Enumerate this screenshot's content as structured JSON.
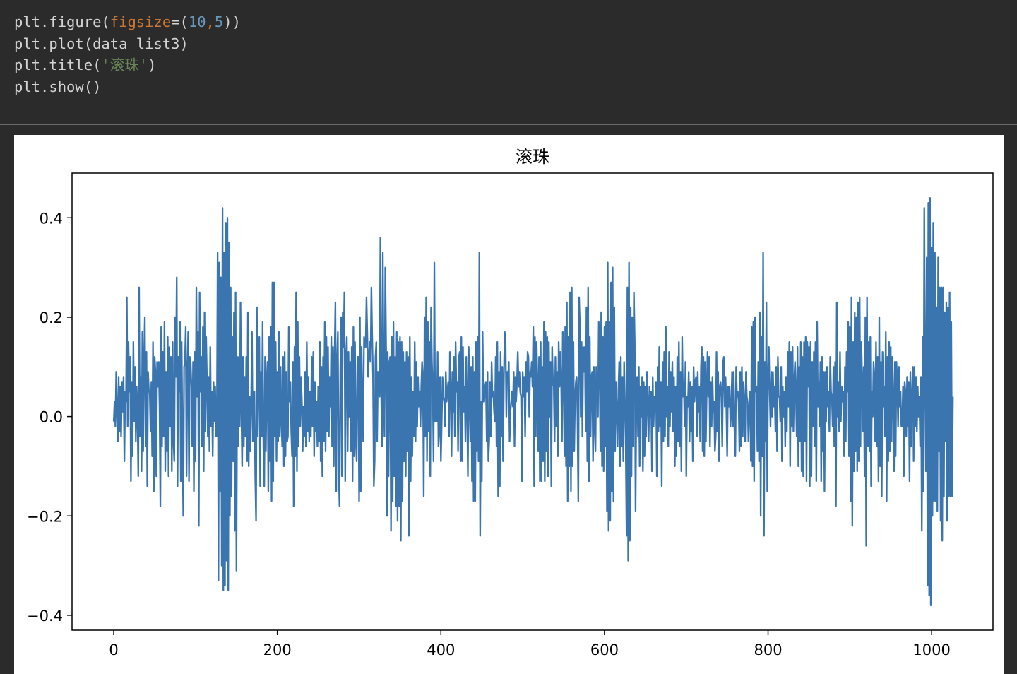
{
  "code": {
    "lines": [
      [
        {
          "t": "plt.figure("
        },
        {
          "t": "figsize",
          "c": "kw"
        },
        {
          "t": "=("
        },
        {
          "t": "10",
          "c": "num"
        },
        {
          "t": ",",
          "c": "kw"
        },
        {
          "t": "5",
          "c": "num"
        },
        {
          "t": "))"
        }
      ],
      [
        {
          "t": "plt.plot(data_list3)"
        }
      ],
      [
        {
          "t": "plt.title("
        },
        {
          "t": "'滚珠'",
          "c": "str"
        },
        {
          "t": ")"
        }
      ],
      [
        {
          "t": "plt.show()"
        }
      ]
    ]
  },
  "colors": {
    "background": "#2b2b2b",
    "code_text": "#d4d4d4",
    "keyword": "#cc7832",
    "number": "#6897bb",
    "string": "#6a8759",
    "line": "#3a75b0"
  },
  "chart_data": {
    "type": "line",
    "title": "滚珠",
    "xlabel": "",
    "ylabel": "",
    "xlim": [
      -51,
      1075
    ],
    "ylim": [
      -0.43,
      0.49
    ],
    "xticks": [
      0,
      200,
      400,
      600,
      800,
      1000
    ],
    "xtick_labels": [
      "0",
      "200",
      "400",
      "600",
      "800",
      "1000"
    ],
    "yticks": [
      -0.4,
      -0.2,
      0.0,
      0.2,
      0.4
    ],
    "ytick_labels": [
      "−0.4",
      "−0.2",
      "0.0",
      "0.2",
      "0.4"
    ],
    "grid": false,
    "series": [
      {
        "x_start": 0,
        "x_step": 1,
        "values": [
          -0.01,
          0.03,
          -0.02,
          0.09,
          0.01,
          -0.05,
          0.08,
          -0.03,
          0.06,
          -0.04,
          0.07,
          0.01,
          0.08,
          -0.09,
          0.05,
          0.03,
          0.24,
          -0.02,
          0.15,
          0.05,
          0.12,
          -0.13,
          0.07,
          -0.08,
          0.15,
          -0.01,
          0.1,
          -0.05,
          0.06,
          0.01,
          -0.12,
          0.26,
          -0.04,
          0.08,
          -0.11,
          0.17,
          -0.07,
          0.12,
          0.2,
          -0.06,
          0.13,
          -0.14,
          0.09,
          0.05,
          0.05,
          -0.03,
          0.07,
          -0.08,
          0.15,
          -0.15,
          0.12,
          0.09,
          -0.12,
          0.11,
          0.06,
          0.11,
          0.02,
          -0.18,
          0.18,
          -0.06,
          0.13,
          -0.04,
          0.19,
          -0.11,
          0.09,
          -0.07,
          0.16,
          -0.12,
          0.14,
          -0.02,
          0.12,
          -0.11,
          0.15,
          -0.05,
          -0.09,
          0.2,
          0.08,
          0.28,
          -0.14,
          0.12,
          0.05,
          0.19,
          -0.13,
          0.15,
          -0.04,
          -0.2,
          0.1,
          0.11,
          0.18,
          -0.12,
          0.09,
          0.17,
          -0.13,
          0.12,
          0.11,
          0.06,
          -0.06,
          0.11,
          -0.15,
          0.13,
          -0.09,
          0.26,
          0.04,
          0.17,
          -0.22,
          0.25,
          0.05,
          0.12,
          -0.06,
          0.18,
          -0.11,
          0.21,
          -0.03,
          0.16,
          0.07,
          -0.04,
          0.08,
          -0.07,
          0.14,
          -0.02,
          0.05,
          -0.08,
          0.07,
          -0.01,
          0.06,
          -0.04,
          -0.04,
          0.33,
          -0.33,
          0.31,
          -0.15,
          0.28,
          -0.3,
          0.42,
          -0.35,
          0.33,
          -0.34,
          0.39,
          -0.29,
          0.4,
          -0.35,
          0.35,
          -0.2,
          0.26,
          -0.16,
          0.16,
          -0.09,
          0.21,
          -0.23,
          0.25,
          -0.31,
          0.12,
          -0.06,
          0.12,
          -0.02,
          0.23,
          0.02,
          -0.1,
          0.12,
          -0.06,
          0.08,
          -0.04,
          0.12,
          -0.09,
          0.21,
          -0.1,
          0.04,
          -0.07,
          0.03,
          0.17,
          -0.05,
          0.05,
          0.05,
          -0.12,
          -0.21,
          0.22,
          -0.04,
          0.09,
          0.16,
          -0.14,
          0.09,
          -0.04,
          0.19,
          -0.06,
          -0.14,
          0.12,
          -0.07,
          0.07,
          0.11,
          -0.15,
          0.16,
          -0.09,
          0.18,
          -0.17,
          0.27,
          -0.13,
          0.27,
          -0.04,
          0.15,
          -0.09,
          0.09,
          -0.05,
          0.17,
          -0.04,
          0.1,
          -0.01,
          -0.06,
          0.12,
          -0.1,
          0.13,
          -0.08,
          0.09,
          -0.05,
          -0.04,
          0.18,
          0.03,
          0.07,
          -0.03,
          -0.08,
          0.11,
          -0.18,
          0.14,
          -0.08,
          0.25,
          -0.11,
          0.19,
          -0.06,
          0.12,
          -0.02,
          0.08,
          0.03,
          -0.07,
          0.02,
          -0.04,
          0.09,
          -0.06,
          0.15,
          -0.03,
          0.08,
          -0.05,
          0.05,
          -0.04,
          0.12,
          -0.02,
          0.13,
          -0.08,
          0.07,
          -0.03,
          0.03,
          -0.06,
          0.06,
          -0.05,
          0.15,
          -0.09,
          0.1,
          -0.12,
          0.12,
          -0.05,
          0.19,
          -0.07,
          0.16,
          -0.03,
          0.14,
          -0.04,
          0.08,
          0.02,
          0.16,
          -0.06,
          0.14,
          -0.1,
          0.12,
          0.23,
          -0.15,
          0.11,
          0.17,
          -0.11,
          -0.18,
          0.09,
          0.2,
          -0.12,
          0.21,
          0.14,
          0.25,
          -0.13,
          0.12,
          0.16,
          -0.07,
          0.13,
          0.0,
          0.11,
          -0.07,
          0.14,
          -0.13,
          0.18,
          -0.08,
          0.15,
          -0.05,
          -0.09,
          0.12,
          0.12,
          -0.17,
          0.2,
          -0.15,
          0.14,
          0.03,
          -0.05,
          0.16,
          0.14,
          0.14,
          0.24,
          0.17,
          0.08,
          0.12,
          0.15,
          0.11,
          0.26,
          0.16,
          0.08,
          -0.14,
          -0.09,
          0.12,
          0.15,
          -0.05,
          0.09,
          0.05,
          0.04,
          0.36,
          0.05,
          -0.06,
          0.33,
          0.06,
          -0.04,
          0.3,
          0.14,
          -0.2,
          0.13,
          -0.12,
          0.11,
          0.12,
          -0.23,
          0.16,
          -0.17,
          0.19,
          -0.12,
          0.12,
          -0.18,
          0.17,
          -0.21,
          0.15,
          -0.18,
          0.16,
          -0.25,
          0.15,
          -0.17,
          0.13,
          -0.09,
          0.11,
          -0.12,
          0.13,
          -0.07,
          0.12,
          -0.24,
          0.16,
          -0.13,
          0.08,
          -0.08,
          0.05,
          -0.04,
          0.15,
          -0.05,
          0.11,
          -0.02,
          0.08,
          0.02,
          0.05,
          -0.02,
          0.06,
          0.11,
          0.08,
          -0.16,
          0.2,
          -0.04,
          0.24,
          -0.09,
          0.19,
          -0.03,
          0.15,
          -0.12,
          0.22,
          0.11,
          0.06,
          -0.09,
          0.31,
          -0.01,
          0.05,
          -0.01,
          0.13,
          -0.06,
          -0.03,
          0.08,
          -0.09,
          -0.01,
          0.08,
          0.04,
          0.03,
          -0.02,
          0.09,
          0.03,
          0.05,
          0.07,
          -0.04,
          0.13,
          0.06,
          -0.08,
          0.09,
          0.01,
          0.12,
          -0.04,
          0.15,
          0.05,
          0.07,
          -0.07,
          0.12,
          0.13,
          -0.09,
          0.16,
          -0.09,
          0.14,
          0.01,
          0.06,
          -0.05,
          0.12,
          0.03,
          -0.12,
          0.14,
          0.03,
          -0.05,
          0.1,
          -0.13,
          0.12,
          -0.17,
          0.09,
          -0.17,
          0.15,
          -0.07,
          0.16,
          -0.09,
          0.33,
          -0.24,
          0.03,
          -0.13,
          0.17,
          0.03,
          0.03,
          0.06,
          0.07,
          -0.05,
          0.09,
          -0.09,
          -0.05,
          0.07,
          -0.04,
          0.11,
          0.04,
          0.05,
          0.01,
          -0.01,
          0.12,
          -0.06,
          0.15,
          -0.16,
          0.09,
          -0.14,
          0.13,
          -0.04,
          0.1,
          -0.09,
          0.08,
          0.17,
          0.16,
          0.0,
          0.09,
          0.07,
          0.11,
          -0.05,
          0.01,
          0.03,
          0.05,
          0.02,
          0.09,
          -0.06,
          0.08,
          0.03,
          0.07,
          0.13,
          0.06,
          0.09,
          0.05,
          0.04,
          -0.13,
          0.09,
          0.04,
          0.08,
          -0.04,
          0.11,
          0.05,
          0.13,
          0.12,
          0.0,
          0.09,
          0.08,
          0.11,
          0.06,
          0.18,
          -0.14,
          0.16,
          -0.04,
          0.15,
          0.07,
          -0.07,
          0.12,
          -0.13,
          0.15,
          -0.13,
          0.1,
          -0.09,
          0.19,
          -0.13,
          0.17,
          -0.07,
          0.16,
          -0.12,
          0.15,
          0.0,
          0.11,
          -0.14,
          0.14,
          0.07,
          0.06,
          -0.05,
          0.12,
          -0.02,
          0.09,
          -0.08,
          0.15,
          0.06,
          0.13,
          0.07,
          -0.05,
          0.17,
          0.1,
          -0.08,
          0.18,
          -0.1,
          0.23,
          -0.17,
          0.16,
          -0.1,
          0.25,
          -0.15,
          0.26,
          -0.1,
          0.15,
          -0.07,
          0.04,
          0.07,
          0.08,
          0.0,
          -0.17,
          0.24,
          0.18,
          0.0,
          0.15,
          -0.04,
          0.14,
          0.09,
          0.14,
          -0.03,
          0.22,
          -0.09,
          0.26,
          -0.13,
          0.16,
          -0.04,
          0.08,
          0.09,
          -0.09,
          0.1,
          -0.02,
          -0.07,
          0.1,
          0.08,
          0.0,
          0.19,
          0.11,
          -0.07,
          0.21,
          -0.1,
          0.16,
          -0.11,
          0.18,
          -0.06,
          0.19,
          -0.19,
          0.31,
          -0.23,
          0.19,
          -0.21,
          0.27,
          -0.15,
          0.3,
          -0.17,
          0.22,
          -0.07,
          0.07,
          0.02,
          -0.06,
          0.05,
          0.11,
          -0.1,
          0.12,
          -0.06,
          0.08,
          -0.09,
          0.11,
          0.03,
          -0.06,
          -0.24,
          0.26,
          -0.29,
          0.31,
          -0.25,
          0.22,
          -0.12,
          0.2,
          -0.06,
          0.25,
          0.15,
          -0.19,
          0.04,
          0.08,
          -0.04,
          0.1,
          -0.1,
          0.06,
          0.0,
          0.08,
          -0.11,
          0.07,
          -0.08,
          0.06,
          -0.04,
          0.09,
          0.03,
          -0.05,
          0.06,
          0.0,
          0.05,
          -0.11,
          0.08,
          -0.02,
          0.04,
          0.01,
          0.07,
          -0.12,
          0.1,
          -0.03,
          0.14,
          -0.02,
          0.07,
          -0.14,
          0.11,
          -0.05,
          0.13,
          -0.04,
          0.18,
          0.0,
          0.06,
          -0.06,
          0.13,
          -0.02,
          0.09,
          0.01,
          0.11,
          -0.03,
          0.08,
          -0.1,
          0.06,
          -0.08,
          0.12,
          -0.05,
          0.15,
          -0.06,
          0.09,
          -0.11,
          0.16,
          0.04,
          0.07,
          -0.02,
          0.11,
          -0.12,
          0.04,
          0.02,
          0.09,
          -0.05,
          0.07,
          -0.03,
          0.06,
          -0.09,
          0.1,
          0.03,
          0.07,
          0.08,
          -0.04,
          0.09,
          0.01,
          0.06,
          -0.05,
          0.1,
          0.14,
          -0.07,
          0.12,
          -0.08,
          0.11,
          -0.05,
          0.05,
          0.13,
          0.04,
          0.12,
          -0.06,
          0.07,
          -0.02,
          0.08,
          0.01,
          0.03,
          -0.07,
          -0.04,
          0.13,
          -0.03,
          0.09,
          -0.09,
          0.06,
          0.07,
          0.04,
          -0.06,
          0.11,
          0.12,
          0.02,
          0.08,
          0.02,
          -0.08,
          0.06,
          0.02,
          0.06,
          -0.02,
          0.01,
          0.09,
          -0.02,
          0.09,
          -0.03,
          -0.08,
          0.1,
          0.04,
          0.05,
          0.03,
          -0.07,
          0.09,
          -0.06,
          0.1,
          -0.04,
          0.07,
          0.03,
          -0.05,
          0.09,
          0.04,
          0.03,
          -0.05,
          0.02,
          0.05,
          -0.09,
          0.18,
          -0.1,
          0.19,
          -0.13,
          0.2,
          0.05,
          0.06,
          -0.07,
          0.11,
          -0.09,
          0.21,
          -0.2,
          0.16,
          -0.08,
          0.33,
          -0.24,
          0.11,
          -0.05,
          0.23,
          -0.15,
          0.08,
          0.14,
          0.05,
          -0.02,
          0.09,
          0.0,
          0.09,
          0.02,
          0.06,
          -0.03,
          0.1,
          -0.07,
          0.12,
          0.04,
          0.04,
          -0.01,
          0.1,
          -0.09,
          0.06,
          0.0,
          0.05,
          -0.06,
          0.08,
          -0.03,
          0.13,
          0.02,
          0.15,
          -0.1,
          0.13,
          -0.02,
          0.14,
          -0.03,
          0.07,
          0.11,
          0.05,
          -0.04,
          0.14,
          -0.1,
          0.1,
          -0.05,
          0.15,
          -0.11,
          0.12,
          -0.12,
          0.15,
          -0.05,
          0.16,
          -0.13,
          0.15,
          0.06,
          0.14,
          -0.14,
          0.15,
          -0.12,
          0.11,
          -0.02,
          0.13,
          -0.06,
          0.15,
          -0.13,
          0.19,
          0.02,
          0.07,
          -0.02,
          0.11,
          -0.13,
          0.12,
          -0.07,
          0.09,
          -0.15,
          0.09,
          -0.01,
          0.1,
          0.02,
          0.05,
          -0.03,
          0.12,
          0.05,
          0.04,
          -0.02,
          0.1,
          -0.06,
          0.11,
          -0.18,
          0.23,
          0.0,
          0.07,
          -0.03,
          0.13,
          -0.01,
          0.06,
          0.03,
          0.05,
          -0.08,
          0.1,
          -0.05,
          0.13,
          0.05,
          0.19,
          -0.08,
          0.18,
          -0.17,
          0.24,
          -0.22,
          0.15,
          -0.11,
          0.21,
          -0.07,
          0.2,
          -0.11,
          0.23,
          -0.09,
          0.24,
          -0.06,
          0.15,
          0.08,
          -0.03,
          0.1,
          -0.12,
          0.2,
          -0.26,
          0.24,
          -0.06,
          0.15,
          -0.07,
          0.16,
          -0.14,
          0.05,
          0.0,
          0.11,
          0.08,
          -0.05,
          0.15,
          -0.06,
          0.12,
          -0.13,
          0.2,
          -0.1,
          0.11,
          -0.16,
          0.13,
          0.02,
          0.06,
          -0.04,
          0.17,
          -0.17,
          0.12,
          -0.09,
          0.15,
          -0.07,
          0.14,
          -0.05,
          0.12,
          0.04,
          -0.11,
          0.11,
          -0.08,
          0.11,
          0.07,
          -0.02,
          0.1,
          0.02,
          0.05,
          -0.02,
          -0.02,
          0.06,
          -0.12,
          0.07,
          0.05,
          -0.04,
          0.08,
          -0.02,
          0.07,
          -0.13,
          0.09,
          -0.06,
          0.04,
          0.1,
          -0.09,
          0.1,
          -0.02,
          0.08,
          -0.03,
          0.06,
          0.0,
          0.04,
          -0.06,
          0.08,
          -0.23,
          0.16,
          -0.15,
          0.42,
          0.07,
          -0.11,
          0.32,
          -0.34,
          0.43,
          -0.36,
          0.44,
          -0.38,
          0.34,
          -0.2,
          0.39,
          -0.17,
          0.33,
          -0.17,
          0.22,
          -0.19,
          0.32,
          -0.07,
          0.26,
          -0.21,
          0.26,
          -0.25,
          0.26,
          -0.16,
          0.21,
          -0.05,
          0.23,
          -0.21,
          0.22,
          -0.16,
          0.25,
          -0.16,
          0.19,
          -0.16,
          0.04
        ]
      }
    ]
  }
}
